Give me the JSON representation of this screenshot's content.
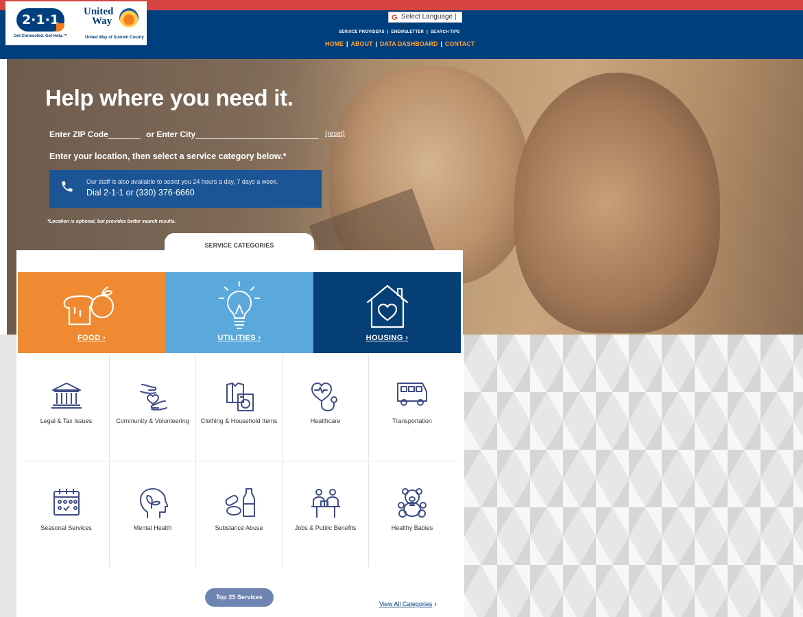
{
  "header": {
    "logo_211": {
      "text": "2·1·1",
      "tagline": "Get Connected. Get Help.™"
    },
    "logo_uw": {
      "text_line1": "United",
      "text_line2": "Way",
      "tagline": "United Way of Summit County"
    },
    "language_select": "Select Language",
    "nav_top": [
      "SERVICE PROVIDERS",
      "ENEWSLETTER",
      "SEARCH TIPS"
    ],
    "nav_main": [
      "HOME",
      "ABOUT",
      "DATA DASHBOARD",
      "CONTACT"
    ],
    "colors": {
      "primary": "#003f7d",
      "accent": "#f6a13c",
      "top_stripe": "#d64541"
    }
  },
  "hero": {
    "title": "Help where you need it.",
    "zip_label": "Enter ZIP Code",
    "zip_value": "",
    "city_label": "or Enter City",
    "city_value": "",
    "reset_label": "(reset)",
    "instruction": "Enter your location, then select a service category below.*",
    "call_line1": "Our staff is also available to assist you 24 hours a day, 7 days a week.",
    "call_line2": "Dial  2-1-1   or   (330) 376-6660",
    "footnote": "*Location is optional, but provides better search results."
  },
  "categories": {
    "tab_label": "SERVICE CATEGORIES",
    "featured": [
      {
        "label": "FOOD  ›",
        "icon": "bread-apple-icon",
        "color": "#ef8a32"
      },
      {
        "label": "UTILITIES  ›",
        "icon": "lightbulb-icon",
        "color": "#5ba8dd"
      },
      {
        "label": "HOUSING  ›",
        "icon": "house-heart-icon",
        "color": "#053f76"
      }
    ],
    "items": [
      {
        "label": "Legal & Tax Issues",
        "icon": "courthouse-icon"
      },
      {
        "label": "Community & Volunteering",
        "icon": "hands-heart-icon"
      },
      {
        "label": "Clothing & Household Items",
        "icon": "shirt-washer-icon"
      },
      {
        "label": "Healthcare",
        "icon": "stethoscope-icon"
      },
      {
        "label": "Transportation",
        "icon": "bus-icon"
      },
      {
        "label": "Seasonal Services",
        "icon": "calendar-icon"
      },
      {
        "label": "Mental Health",
        "icon": "head-leaf-icon"
      },
      {
        "label": "Substance Abuse",
        "icon": "pills-bottle-icon"
      },
      {
        "label": "Jobs & Public Benefits",
        "icon": "people-desk-icon"
      },
      {
        "label": "Healthy Babies",
        "icon": "teddy-bear-icon"
      }
    ],
    "top25_label": "Top 25 Services",
    "view_all_label": "View All Categories"
  }
}
